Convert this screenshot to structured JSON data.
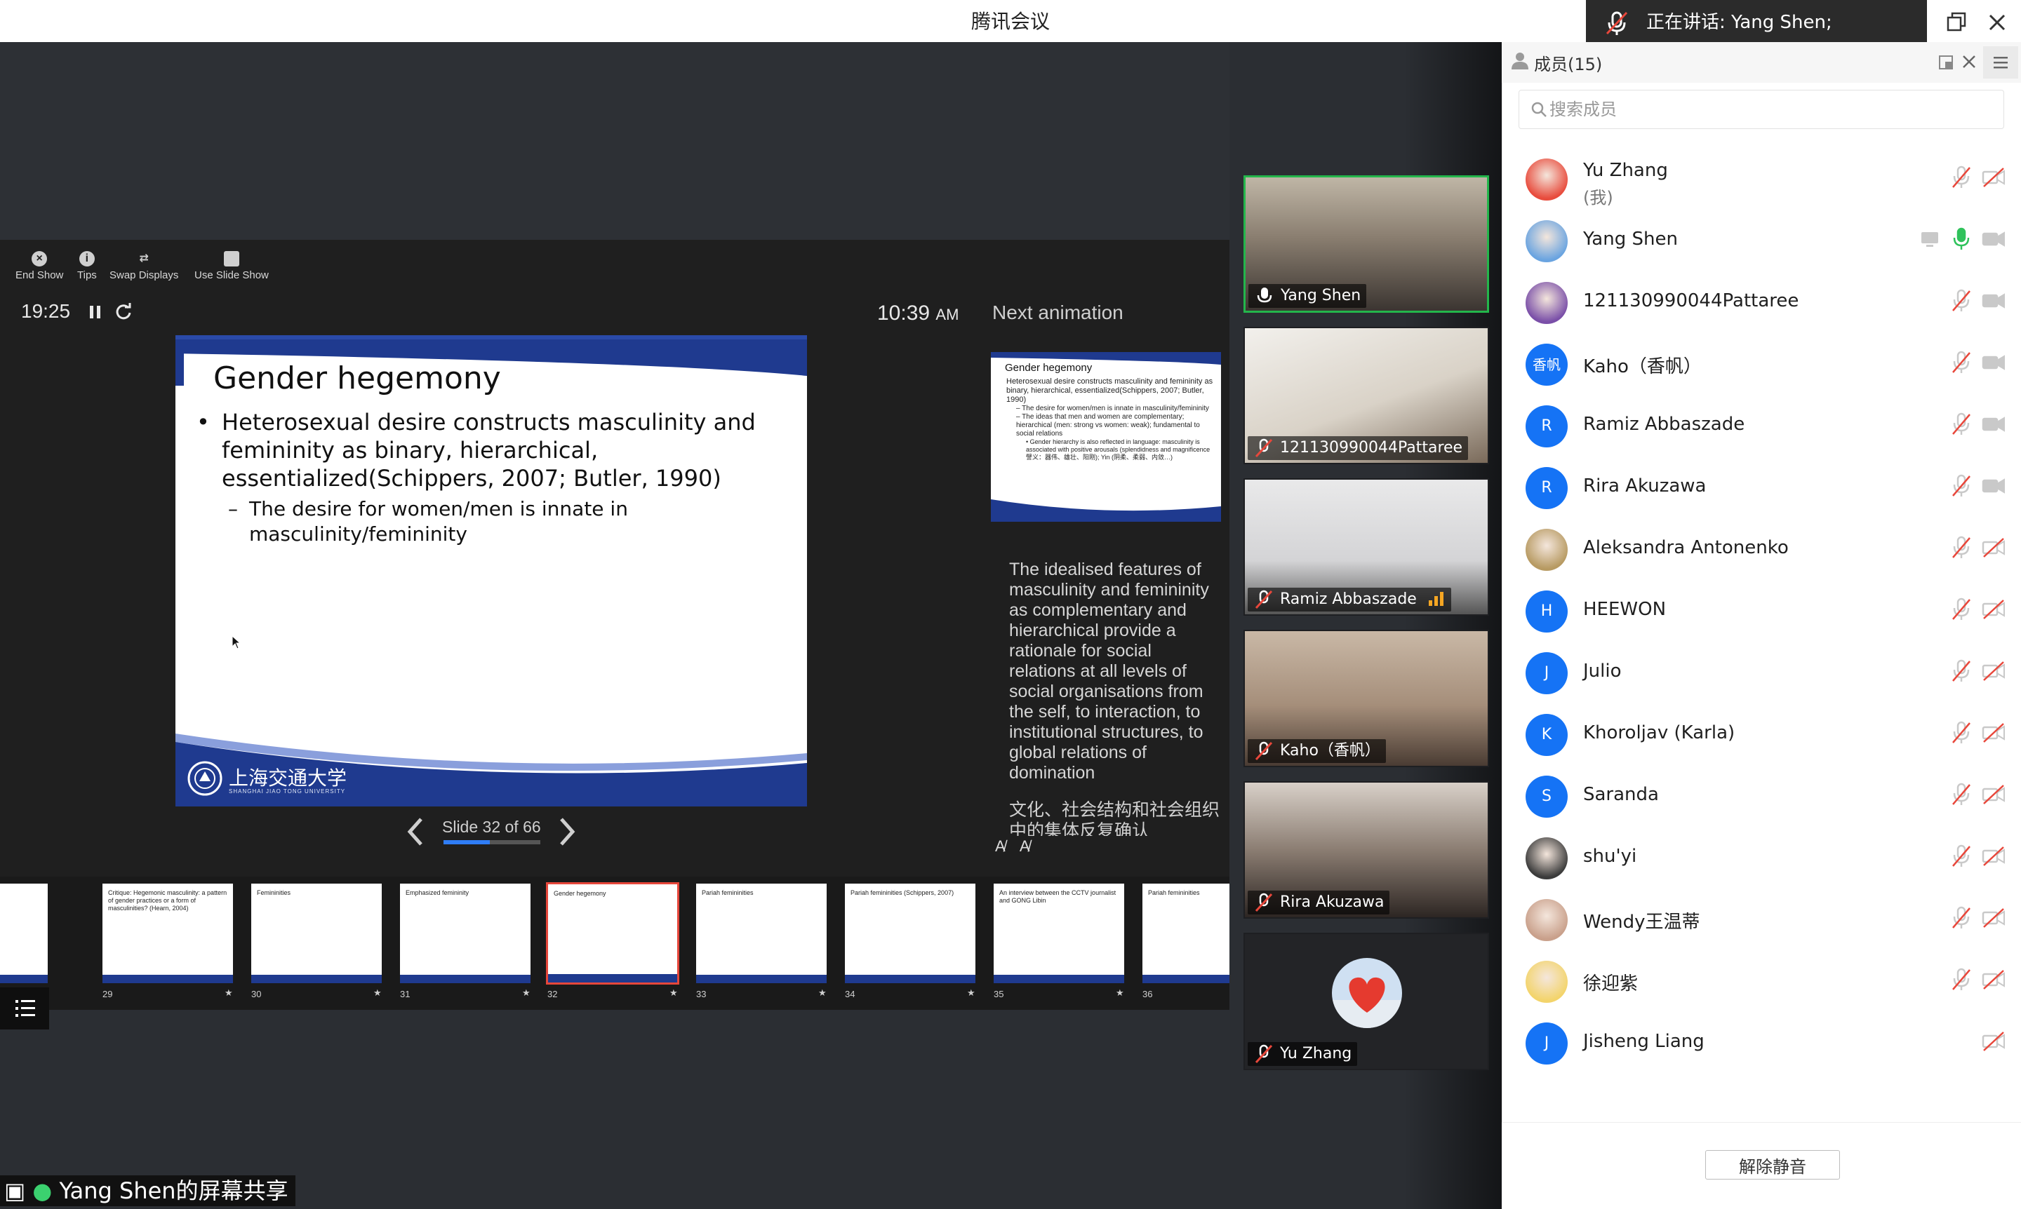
{
  "app": {
    "title": "腾讯会议",
    "speaking_label": "正在讲话: Yang Shen;"
  },
  "share": {
    "caption": "Yang Shen的屏幕共享",
    "toolbar": [
      {
        "label": "End Show",
        "icon": "close-circle-icon"
      },
      {
        "label": "Tips",
        "icon": "info-icon"
      },
      {
        "label": "Swap Displays",
        "icon": "swap-icon"
      },
      {
        "label": "Use Slide Show",
        "icon": "slideshow-icon"
      }
    ],
    "timer": "19:25",
    "clock_time": "10:39",
    "clock_ampm": "AM",
    "next_label": "Next animation",
    "slide_counter": "Slide 32 of 66",
    "progress": 0.48,
    "notes_en": "The idealised features of masculinity and femininity as complementary and hierarchical provide a rationale for social relations at all levels of social organisations from the self, to interaction, to institutional structures, to global relations of domination",
    "notes_zh": "文化、社会结构和社会组织中的集体反复确认"
  },
  "slide": {
    "title": "Gender hegemony",
    "bullet1": "Heterosexual desire constructs masculinity and femininity as binary, hierarchical, essentialized(Schippers, 2007; Butler, 1990)",
    "bullet2": "The desire for women/men is innate in masculinity/femininity",
    "logo_text": "上海交通大学",
    "logo_sub": "SHANGHAI JIAO TONG UNIVERSITY"
  },
  "next_slide": {
    "title": "Gender hegemony",
    "bullet1": "Heterosexual desire constructs masculinity and femininity as binary, hierarchical, essentialized(Schippers, 2007; Butler, 1990)",
    "sub1": "– The desire for women/men is innate in masculinity/femininity",
    "sub2": "– The ideas that men and women are complementary; hierarchical (men: strong vs women: weak); fundamental to social relations",
    "sub3": "• Gender hierarchy is also reflected in language: masculinity is associated with positive arousals (splendidness and magnificence 譬义：器伟、雄壮、阳刚); Yin (阴柔、柔弱、内敛…)"
  },
  "thumbnails": [
    {
      "num": "",
      "title": "nd Violence",
      "active": false
    },
    {
      "num": "29",
      "title": "Critique: Hegemonic masculinity: a pattern of gender practices or a form of masculinities? (Hearn, 2004)",
      "active": false
    },
    {
      "num": "30",
      "title": "Femininities",
      "active": false
    },
    {
      "num": "31",
      "title": "Emphasized femininity",
      "active": false
    },
    {
      "num": "32",
      "title": "Gender hegemony",
      "active": true
    },
    {
      "num": "33",
      "title": "Pariah femininities",
      "active": false
    },
    {
      "num": "34",
      "title": "Pariah femininities (Schippers, 2007)",
      "active": false
    },
    {
      "num": "35",
      "title": "An interview between the CCTV journalist and GONG Libin",
      "active": false
    },
    {
      "num": "36",
      "title": "Pariah femininities",
      "active": false
    }
  ],
  "video_tiles": [
    {
      "name": "Yang Shen",
      "speaking": true,
      "mic": "on"
    },
    {
      "name": "121130990044Pattaree",
      "speaking": false,
      "mic": "muted"
    },
    {
      "name": "Ramiz Abbaszade",
      "speaking": false,
      "mic": "muted",
      "signal": true
    },
    {
      "name": "Kaho（香帆）",
      "speaking": false,
      "mic": "muted"
    },
    {
      "name": "Rira Akuzawa",
      "speaking": false,
      "mic": "muted"
    },
    {
      "name": "Yu Zhang",
      "speaking": false,
      "mic": "muted",
      "avatar": true
    }
  ],
  "members_panel": {
    "title": "成员(15)",
    "search_placeholder": "搜索成员",
    "unmute_all_label": "解除静音",
    "members": [
      {
        "name": "Yu Zhang",
        "sub": "(我)",
        "avatar": "img",
        "avatar_color": "#e84c3d",
        "mic": "muted",
        "cam": "off"
      },
      {
        "name": "Yang Shen",
        "sub": "",
        "avatar": "img",
        "avatar_color": "#6aa4e0",
        "mic": "on",
        "cam": "on",
        "screen": true
      },
      {
        "name": "121130990044Pattaree",
        "sub": "",
        "avatar": "img",
        "avatar_color": "#7a4fa8",
        "mic": "muted",
        "cam": "on"
      },
      {
        "name": "Kaho（香帆）",
        "sub": "",
        "avatar": "香帆",
        "avatar_color": "#1573f5",
        "mic": "muted",
        "cam": "on"
      },
      {
        "name": "Ramiz Abbaszade",
        "sub": "",
        "avatar": "R",
        "avatar_color": "#1573f5",
        "mic": "muted",
        "cam": "on"
      },
      {
        "name": "Rira Akuzawa",
        "sub": "",
        "avatar": "R",
        "avatar_color": "#1573f5",
        "mic": "muted",
        "cam": "on"
      },
      {
        "name": "Aleksandra Antonenko",
        "sub": "",
        "avatar": "img",
        "avatar_color": "#b79a62",
        "mic": "muted",
        "cam": "off"
      },
      {
        "name": "HEEWON",
        "sub": "",
        "avatar": "H",
        "avatar_color": "#1573f5",
        "mic": "muted",
        "cam": "off"
      },
      {
        "name": "Julio",
        "sub": "",
        "avatar": "J",
        "avatar_color": "#1573f5",
        "mic": "muted",
        "cam": "off"
      },
      {
        "name": "Khoroljav (Karla)",
        "sub": "",
        "avatar": "K",
        "avatar_color": "#1573f5",
        "mic": "muted",
        "cam": "off"
      },
      {
        "name": "Saranda",
        "sub": "",
        "avatar": "S",
        "avatar_color": "#1573f5",
        "mic": "muted",
        "cam": "off"
      },
      {
        "name": "shu'yi",
        "sub": "",
        "avatar": "img",
        "avatar_color": "#3b3b3b",
        "mic": "muted",
        "cam": "off"
      },
      {
        "name": "Wendy王温蒂",
        "sub": "",
        "avatar": "img",
        "avatar_color": "#c9a08b",
        "mic": "muted",
        "cam": "off"
      },
      {
        "name": "徐迎紫",
        "sub": "",
        "avatar": "img",
        "avatar_color": "#f3d46b",
        "mic": "muted",
        "cam": "off"
      },
      {
        "name": "Jisheng Liang",
        "sub": "",
        "avatar": "J",
        "avatar_color": "#1573f5",
        "mic": "none",
        "cam": "off"
      }
    ]
  }
}
